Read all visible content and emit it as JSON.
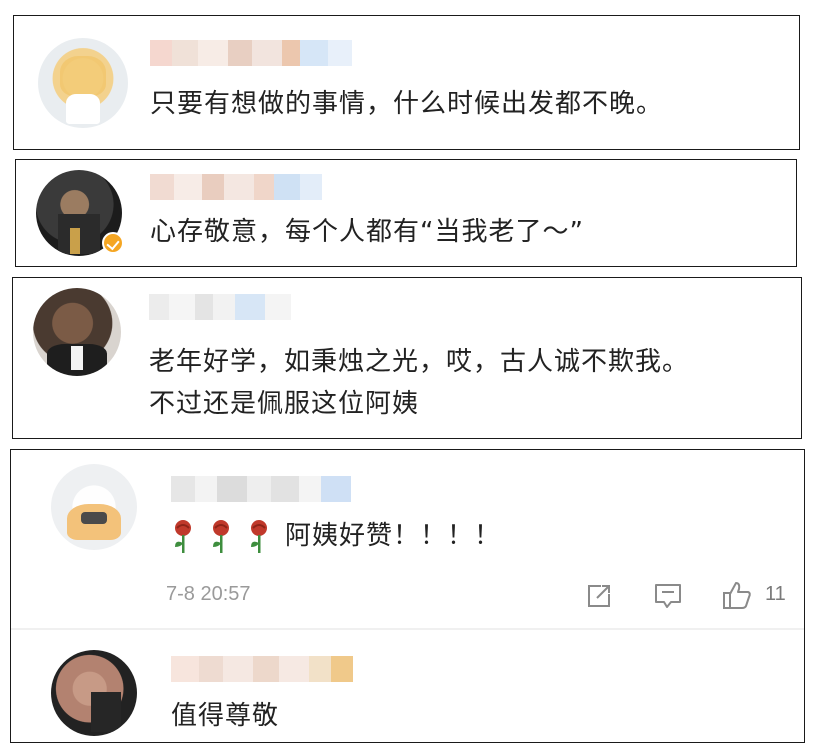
{
  "comments": [
    {
      "text": "只要有想做的事情，什么时候出发都不晚。"
    },
    {
      "text": "心存敬意，每个人都有“当我老了～”"
    },
    {
      "line1": "老年好学，如秉烛之光，哎，古人诚不欺我。",
      "line2": "不过还是佩服这位阿姨"
    },
    {
      "text": "阿姨好赞！！！！",
      "timestamp": "7-8 20:57",
      "like_count": "11"
    },
    {
      "text": "值得尊敬"
    }
  ],
  "colors": {
    "verified_badge": "#f5a623",
    "meta_gray": "#9a9a9a",
    "rose_red": "#c0392b",
    "rose_green": "#3e8e3e"
  },
  "icons": [
    "share-icon",
    "comment-icon",
    "like-icon",
    "verified-badge-icon",
    "rose-emoji"
  ]
}
